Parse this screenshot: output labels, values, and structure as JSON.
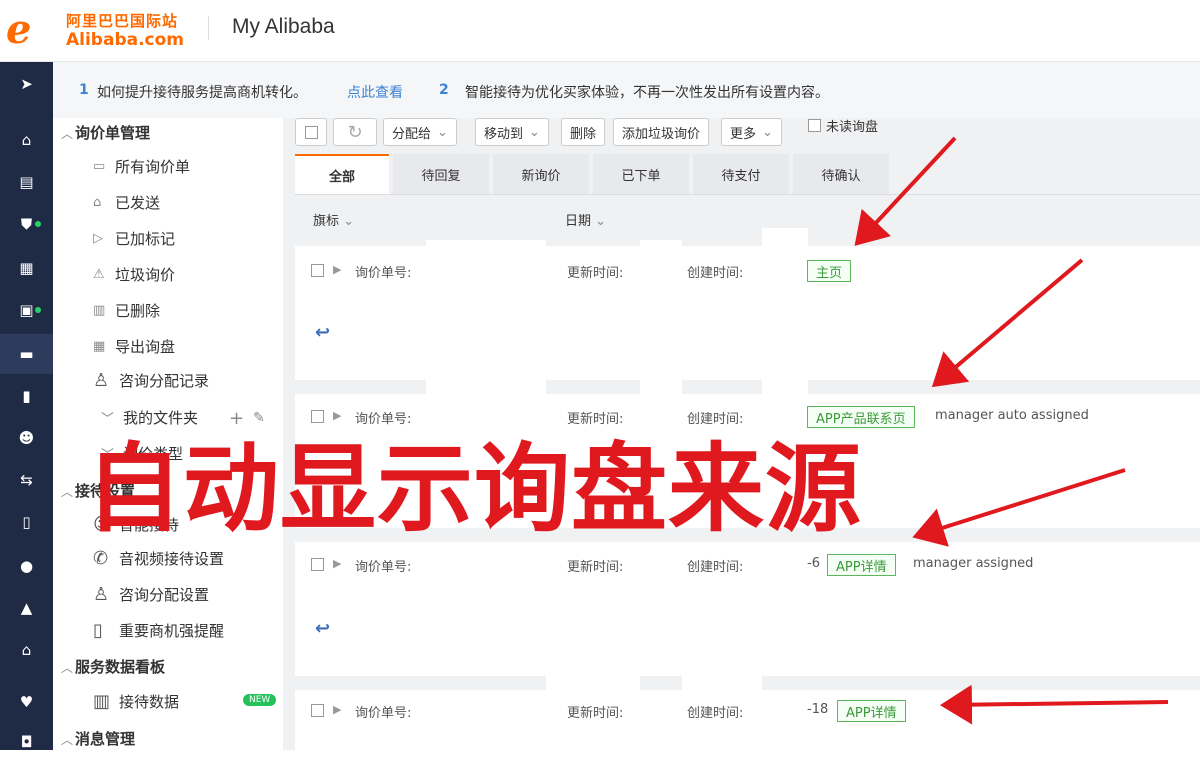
{
  "header": {
    "logo_mark": "e",
    "logo_cn": "阿里巴巴国际站",
    "logo_en": "Alibaba.com",
    "title": "My Alibaba"
  },
  "rail_icons": [
    "send-icon",
    "home-icon",
    "store-icon",
    "shield-icon",
    "grid-icon",
    "box-icon",
    "message-icon",
    "chart-icon",
    "users-icon",
    "fork-icon",
    "clipboard-icon",
    "globe-icon",
    "rocket-icon",
    "bank-icon",
    "heart-icon",
    "bag-icon"
  ],
  "notice": {
    "n1": "1",
    "t1": "如何提升接待服务提高商机转化。",
    "link": "点此查看",
    "n2": "2",
    "t2": "智能接待为优化买家体验，不再一次性发出所有设置内容。"
  },
  "menu": {
    "g1": "询价单管理",
    "items1": [
      "所有询价单",
      "已发送",
      "已加标记",
      "垃圾询价",
      "已删除",
      "导出询盘",
      "咨询分配记录"
    ],
    "folder": "我的文件夹",
    "folder_add": "+",
    "folder_edit": "✎",
    "sub1": "询价类型",
    "g2": "接待设置",
    "item_smart": "智能接待",
    "items2": [
      "音视频接待设置",
      "咨询分配设置",
      "重要商机强提醒"
    ],
    "g3": "服务数据看板",
    "data_item": "接待数据",
    "data_badge": "NEW",
    "g4": "消息管理"
  },
  "toolbar": {
    "assign": "分配给",
    "move": "移动到",
    "delete": "删除",
    "spam": "添加垃圾询价",
    "more": "更多",
    "unread": "未读询盘"
  },
  "tabs": [
    "全部",
    "待回复",
    "新询价",
    "已下单",
    "待支付",
    "待确认"
  ],
  "columns": {
    "flag": "旗标",
    "date": "日期"
  },
  "rows": [
    {
      "no_label": "询价单号:",
      "upd_label": "更新时间:",
      "created_label": "创建时间:",
      "prefix": "",
      "tag": "主页",
      "note": ""
    },
    {
      "no_label": "询价单号:",
      "upd_label": "更新时间:",
      "created_label": "创建时间:",
      "prefix": "",
      "tag": "APP产品联系页",
      "note": "manager auto assigned"
    },
    {
      "no_label": "询价单号:",
      "upd_label": "更新时间:",
      "created_label": "创建时间:",
      "prefix": "-6",
      "tag": "APP详情",
      "note": "manager assigned"
    },
    {
      "no_label": "询价单号:",
      "upd_label": "更新时间:",
      "created_label": "创建时间:",
      "prefix": "-18",
      "tag": "APP详情",
      "note": ""
    }
  ],
  "overlay_text": "自动显示询盘来源",
  "colors": {
    "accent": "#ff6a00",
    "rail": "#1f2a44",
    "overlay": "#e0191f",
    "tag": "#5cb85c",
    "link": "#3b82d6"
  }
}
